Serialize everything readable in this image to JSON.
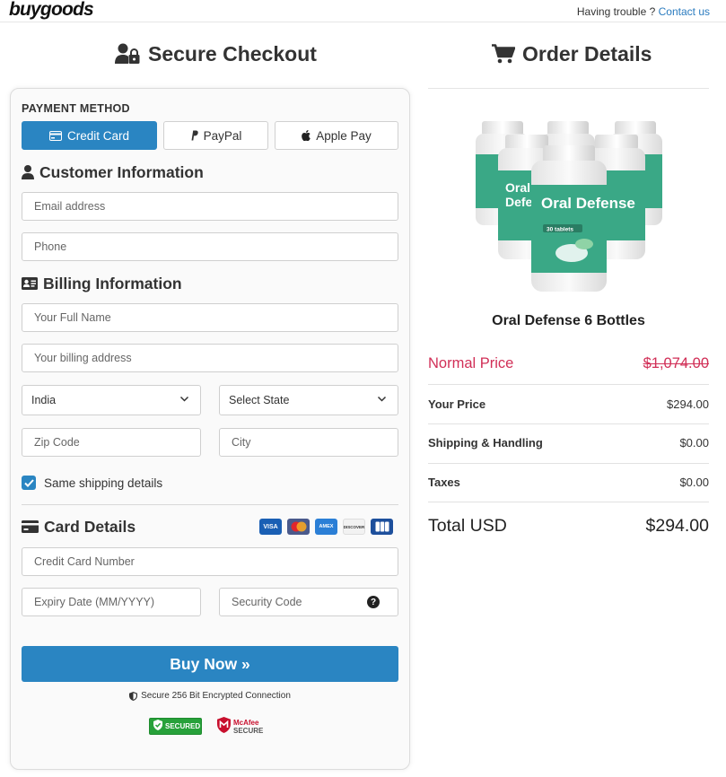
{
  "header": {
    "logo": "buygoods",
    "trouble_text": "Having trouble ?",
    "contact_link": "Contact us"
  },
  "left": {
    "title": "Secure Checkout",
    "payment_method_label": "PAYMENT METHOD",
    "payment_methods": [
      {
        "label": "Credit Card",
        "selected": true,
        "icon": "credit-card-icon"
      },
      {
        "label": "PayPal",
        "selected": false,
        "icon": "paypal-icon"
      },
      {
        "label": "Apple Pay",
        "selected": false,
        "icon": "apple-icon"
      }
    ],
    "customer_title": "Customer Information",
    "email_placeholder": "Email address",
    "phone_placeholder": "Phone",
    "billing_title": "Billing Information",
    "fullname_placeholder": "Your Full Name",
    "address_placeholder": "Your billing address",
    "country_value": "India",
    "state_value": "Select State",
    "zip_placeholder": "Zip Code",
    "city_placeholder": "City",
    "same_shipping_label": "Same shipping details",
    "same_shipping_checked": true,
    "card_title": "Card Details",
    "card_brands": [
      "VISA",
      "Mastercard",
      "AMEX",
      "DISCOVER",
      "JCB"
    ],
    "card_number_placeholder": "Credit Card Number",
    "expiry_placeholder": "Expiry Date (MM/YYYY)",
    "security_placeholder": "Security Code",
    "buy_button": "Buy Now »",
    "encrypted_text": "Secure 256 Bit Encrypted Connection",
    "badge_secured_text": "SECURED",
    "badge_mcafee_line1": "McAfee",
    "badge_mcafee_line2": "SECURE"
  },
  "right": {
    "title": "Order Details",
    "product_label": "Oral Defense",
    "product_sub": "30 tablets",
    "product_name": "Oral Defense 6 Bottles",
    "rows": {
      "normal": {
        "label": "Normal Price",
        "value": "$1,074.00"
      },
      "your": {
        "label": "Your Price",
        "value": "$294.00"
      },
      "shipping": {
        "label": "Shipping & Handling",
        "value": "$0.00"
      },
      "taxes": {
        "label": "Taxes",
        "value": "$0.00"
      },
      "total": {
        "label": "Total USD",
        "value": "$294.00"
      }
    }
  },
  "colors": {
    "accent": "#2a85c2",
    "strike_red": "#d12f57",
    "bottle_green": "#3aa886"
  }
}
